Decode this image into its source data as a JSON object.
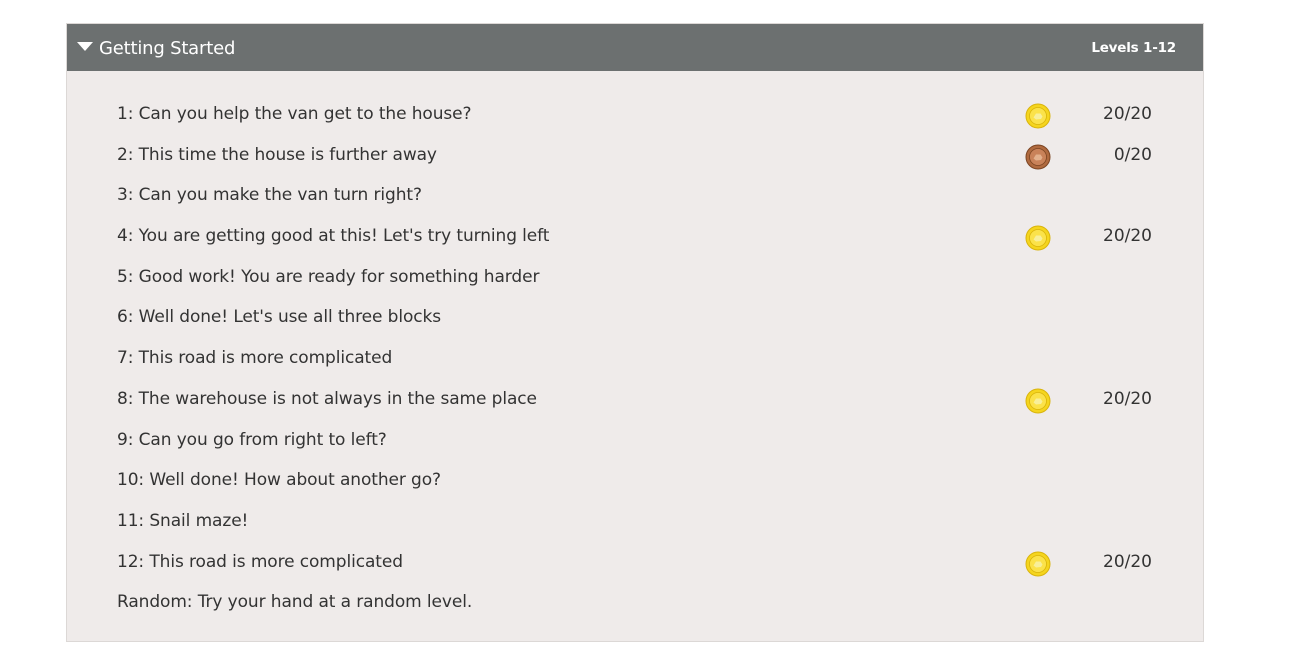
{
  "header": {
    "title": "Getting Started",
    "range": "Levels 1-12"
  },
  "colors": {
    "header_bg": "#6c7070",
    "panel_bg": "#efebea",
    "gold_medal": "#f5d51e",
    "bronze_medal": "#b06a3f"
  },
  "levels": [
    {
      "name": "1: Can you help the van get to the house?",
      "medal": "gold",
      "medal_icon": "gold-medal-icon",
      "score": "20/20"
    },
    {
      "name": "2: This time the house is further away",
      "medal": "bronze",
      "medal_icon": "bronze-medal-icon",
      "score": "0/20"
    },
    {
      "name": "3: Can you make the van turn right?",
      "medal": "",
      "score": ""
    },
    {
      "name": "4: You are getting good at this! Let's try turning left",
      "medal": "gold",
      "medal_icon": "gold-medal-icon",
      "score": "20/20"
    },
    {
      "name": "5: Good work! You are ready for something harder",
      "medal": "",
      "score": ""
    },
    {
      "name": "6: Well done! Let's use all three blocks",
      "medal": "",
      "score": ""
    },
    {
      "name": "7: This road is more complicated",
      "medal": "",
      "score": ""
    },
    {
      "name": "8: The warehouse is not always in the same place",
      "medal": "gold",
      "medal_icon": "gold-medal-icon",
      "score": "20/20"
    },
    {
      "name": "9: Can you go from right to left?",
      "medal": "",
      "score": ""
    },
    {
      "name": "10: Well done! How about another go?",
      "medal": "",
      "score": ""
    },
    {
      "name": "11: Snail maze!",
      "medal": "",
      "score": ""
    },
    {
      "name": "12: This road is more complicated",
      "medal": "gold",
      "medal_icon": "gold-medal-icon",
      "score": "20/20"
    },
    {
      "name": "Random: Try your hand at a random level.",
      "medal": "",
      "score": ""
    }
  ]
}
